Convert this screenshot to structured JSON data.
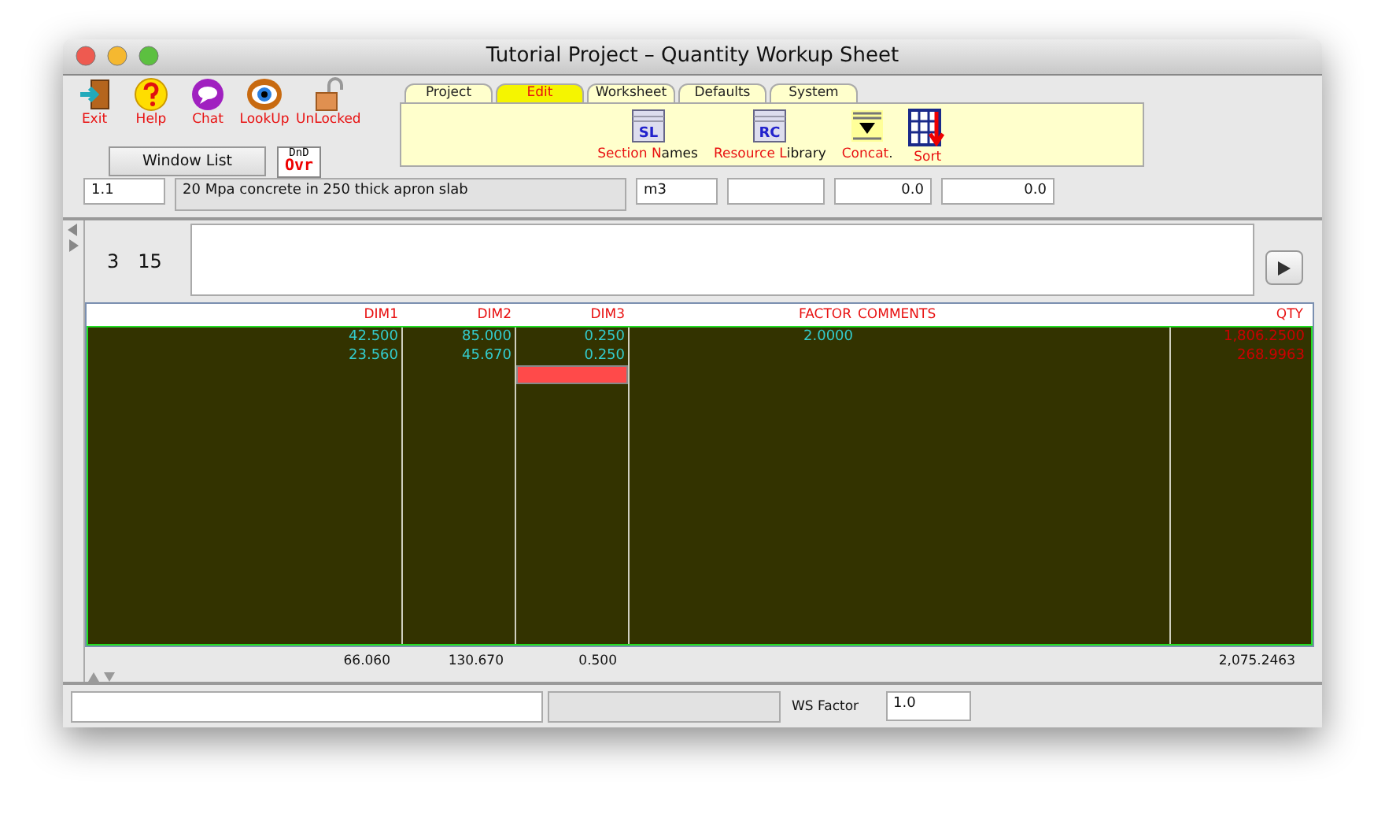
{
  "window": {
    "title": "Tutorial Project – Quantity Workup Sheet"
  },
  "toolbar": [
    {
      "kind": "exit",
      "label": "Exit"
    },
    {
      "kind": "help",
      "label": "Help"
    },
    {
      "kind": "chat",
      "label": "Chat"
    },
    {
      "kind": "lookup",
      "label": "LookUp"
    },
    {
      "kind": "lock",
      "label": "UnLocked"
    }
  ],
  "window_list_button": "Window List",
  "dnd_button": {
    "top": "DnD",
    "bottom": "Ovr"
  },
  "tabs": [
    {
      "label": "Project",
      "selected": false
    },
    {
      "label": "Edit",
      "selected": true
    },
    {
      "label": "Worksheet",
      "selected": false
    },
    {
      "label": "Defaults",
      "selected": false
    },
    {
      "label": "System",
      "selected": false
    }
  ],
  "panel_tools": [
    {
      "kind": "sheet",
      "badge": "SL",
      "label_highlight": "Section N",
      "label_rest": "ames"
    },
    {
      "kind": "sheet",
      "badge": "RC",
      "label_highlight": "Resource L",
      "label_rest": "ibrary"
    },
    {
      "kind": "concat",
      "label_highlight": "Concat",
      "label_rest": "."
    },
    {
      "kind": "sort",
      "label_highlight": "Sort"
    }
  ],
  "item_row": {
    "code": "1.1",
    "description": "20 Mpa concrete in 250 thick apron slab",
    "unit": "m3",
    "value_1": "0.0",
    "value_2": "0.0"
  },
  "counter": {
    "first": "3",
    "second": "15"
  },
  "columns": [
    {
      "label": "DIM1",
      "kind": "input",
      "total": "66.060"
    },
    {
      "label": "DIM2",
      "kind": "input",
      "total": "130.670"
    },
    {
      "label": "DIM3",
      "kind": "input",
      "total": "0.500"
    },
    {
      "label": "FACTOR",
      "kind": "input"
    },
    {
      "label": "COMMENTS",
      "kind": "comment"
    },
    {
      "label": "QTY",
      "kind": "result",
      "total": "2,075.2463"
    }
  ],
  "rows": [
    {
      "cells": [
        {
          "text": "42.500",
          "selected": false
        },
        {
          "text": "85.000",
          "selected": false
        },
        {
          "text": "0.250",
          "selected": false
        },
        {
          "text": "2.0000",
          "selected": false
        },
        {
          "selected": false
        },
        {
          "text": "1,806.2500",
          "selected": false
        }
      ]
    },
    {
      "cells": [
        {
          "text": "23.560",
          "selected": false
        },
        {
          "text": "45.670",
          "selected": false
        },
        {
          "text": "0.250",
          "selected": false
        },
        {
          "selected": false
        },
        {
          "selected": false
        },
        {
          "text": "268.9963",
          "selected": false
        }
      ]
    },
    {
      "cells": [
        {
          "selected": false
        },
        {
          "selected": false
        },
        {
          "selected": true
        },
        {
          "selected": false
        },
        {
          "selected": false
        },
        {
          "selected": false
        }
      ]
    }
  ],
  "status_bar": {
    "ws_factor_label": "WS Factor",
    "ws_factor": "1.0"
  }
}
